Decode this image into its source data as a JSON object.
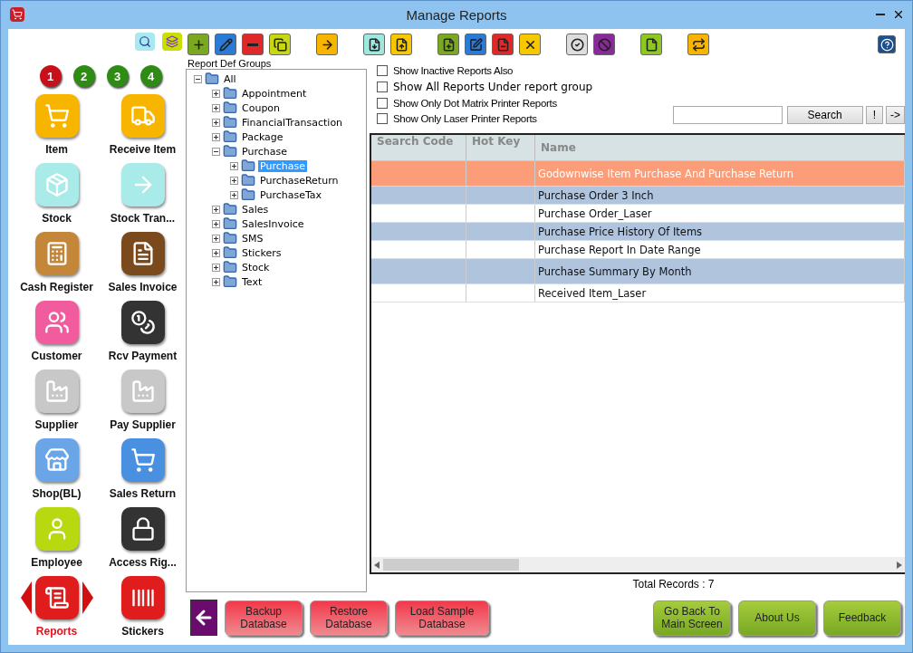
{
  "window": {
    "title": "Manage Reports"
  },
  "pages": [
    {
      "label": "1",
      "selected": true
    },
    {
      "label": "2",
      "selected": false
    },
    {
      "label": "3",
      "selected": false
    },
    {
      "label": "4",
      "selected": false
    }
  ],
  "sidebar": {
    "items": [
      {
        "label": "Item",
        "kind": "item",
        "selected": false
      },
      {
        "label": "Receive Item",
        "kind": "receive",
        "selected": false
      },
      {
        "label": "Stock",
        "kind": "stock",
        "selected": false
      },
      {
        "label": "Stock Tran...",
        "kind": "transfer",
        "selected": false
      },
      {
        "label": "Cash Register",
        "kind": "register",
        "selected": false
      },
      {
        "label": "Sales Invoice",
        "kind": "invoice",
        "selected": false
      },
      {
        "label": "Customer",
        "kind": "customer",
        "selected": false
      },
      {
        "label": "Rcv Payment",
        "kind": "payment",
        "selected": false
      },
      {
        "label": "Supplier",
        "kind": "supplier",
        "selected": false
      },
      {
        "label": "Pay Supplier",
        "kind": "paysupplier",
        "selected": false
      },
      {
        "label": "Shop(BL)",
        "kind": "shop",
        "selected": false
      },
      {
        "label": "Sales Return",
        "kind": "return",
        "selected": false
      },
      {
        "label": "Employee",
        "kind": "employee",
        "selected": false
      },
      {
        "label": "Access Rig...",
        "kind": "access",
        "selected": false
      },
      {
        "label": "Reports",
        "kind": "reports",
        "selected": true
      },
      {
        "label": "Stickers",
        "kind": "stickers",
        "selected": false
      }
    ]
  },
  "tree": {
    "title": "Report Def Groups",
    "items": [
      {
        "label": "All",
        "expanded": true,
        "selected": false,
        "children": [
          {
            "label": "Appointment",
            "expanded": false,
            "selected": false
          },
          {
            "label": "Coupon",
            "expanded": false,
            "selected": false
          },
          {
            "label": "FinancialTransaction",
            "expanded": false,
            "selected": false
          },
          {
            "label": "Package",
            "expanded": false,
            "selected": false
          },
          {
            "label": "Purchase",
            "expanded": true,
            "selected": false,
            "children": [
              {
                "label": "Purchase",
                "expanded": false,
                "selected": true
              },
              {
                "label": "PurchaseReturn",
                "expanded": false,
                "selected": false
              },
              {
                "label": "PurchaseTax",
                "expanded": false,
                "selected": false
              }
            ]
          },
          {
            "label": "Sales",
            "expanded": false,
            "selected": false
          },
          {
            "label": "SalesInvoice",
            "expanded": false,
            "selected": false
          },
          {
            "label": "SMS",
            "expanded": false,
            "selected": false
          },
          {
            "label": "Stickers",
            "expanded": false,
            "selected": false
          },
          {
            "label": "Stock",
            "expanded": false,
            "selected": false
          },
          {
            "label": "Text",
            "expanded": false,
            "selected": false
          }
        ]
      }
    ]
  },
  "filters": [
    {
      "label": "Show Inactive Reports Also",
      "checked": false,
      "kind": "narrow"
    },
    {
      "label": "Show All Reports Under report group",
      "checked": false,
      "kind": "wide"
    },
    {
      "label": "Show Only Dot Matrix Printer Reports",
      "checked": false,
      "kind": "narrow"
    },
    {
      "label": "Show Only Laser Printer Reports",
      "checked": false,
      "kind": "narrow"
    }
  ],
  "search": {
    "button": "Search",
    "bang": "!",
    "next": "->"
  },
  "table": {
    "columns": [
      "Search Code",
      "Hot Key",
      "Name"
    ],
    "rows": [
      {
        "name": "Godownwise Item Purchase And Purchase Return",
        "selected": true,
        "tall": true
      },
      {
        "name": "Purchase Order 3 Inch",
        "selected": false,
        "tall": false
      },
      {
        "name": "Purchase Order_Laser",
        "selected": false,
        "tall": false
      },
      {
        "name": "Purchase Price History Of Items",
        "selected": false,
        "tall": false
      },
      {
        "name": "Purchase Report In Date Range",
        "selected": false,
        "tall": false
      },
      {
        "name": "Purchase Summary By Month",
        "selected": false,
        "tall": true
      },
      {
        "name": "Received Item_Laser",
        "selected": false,
        "tall": false
      }
    ]
  },
  "total": "Total Records : 7",
  "bottom_left": [
    "Backup\nDatabase",
    "Restore\nDatabase",
    "Load Sample\nDatabase"
  ],
  "bottom_right": [
    "Go Back To\nMain Screen",
    "About Us",
    "Feedback"
  ]
}
